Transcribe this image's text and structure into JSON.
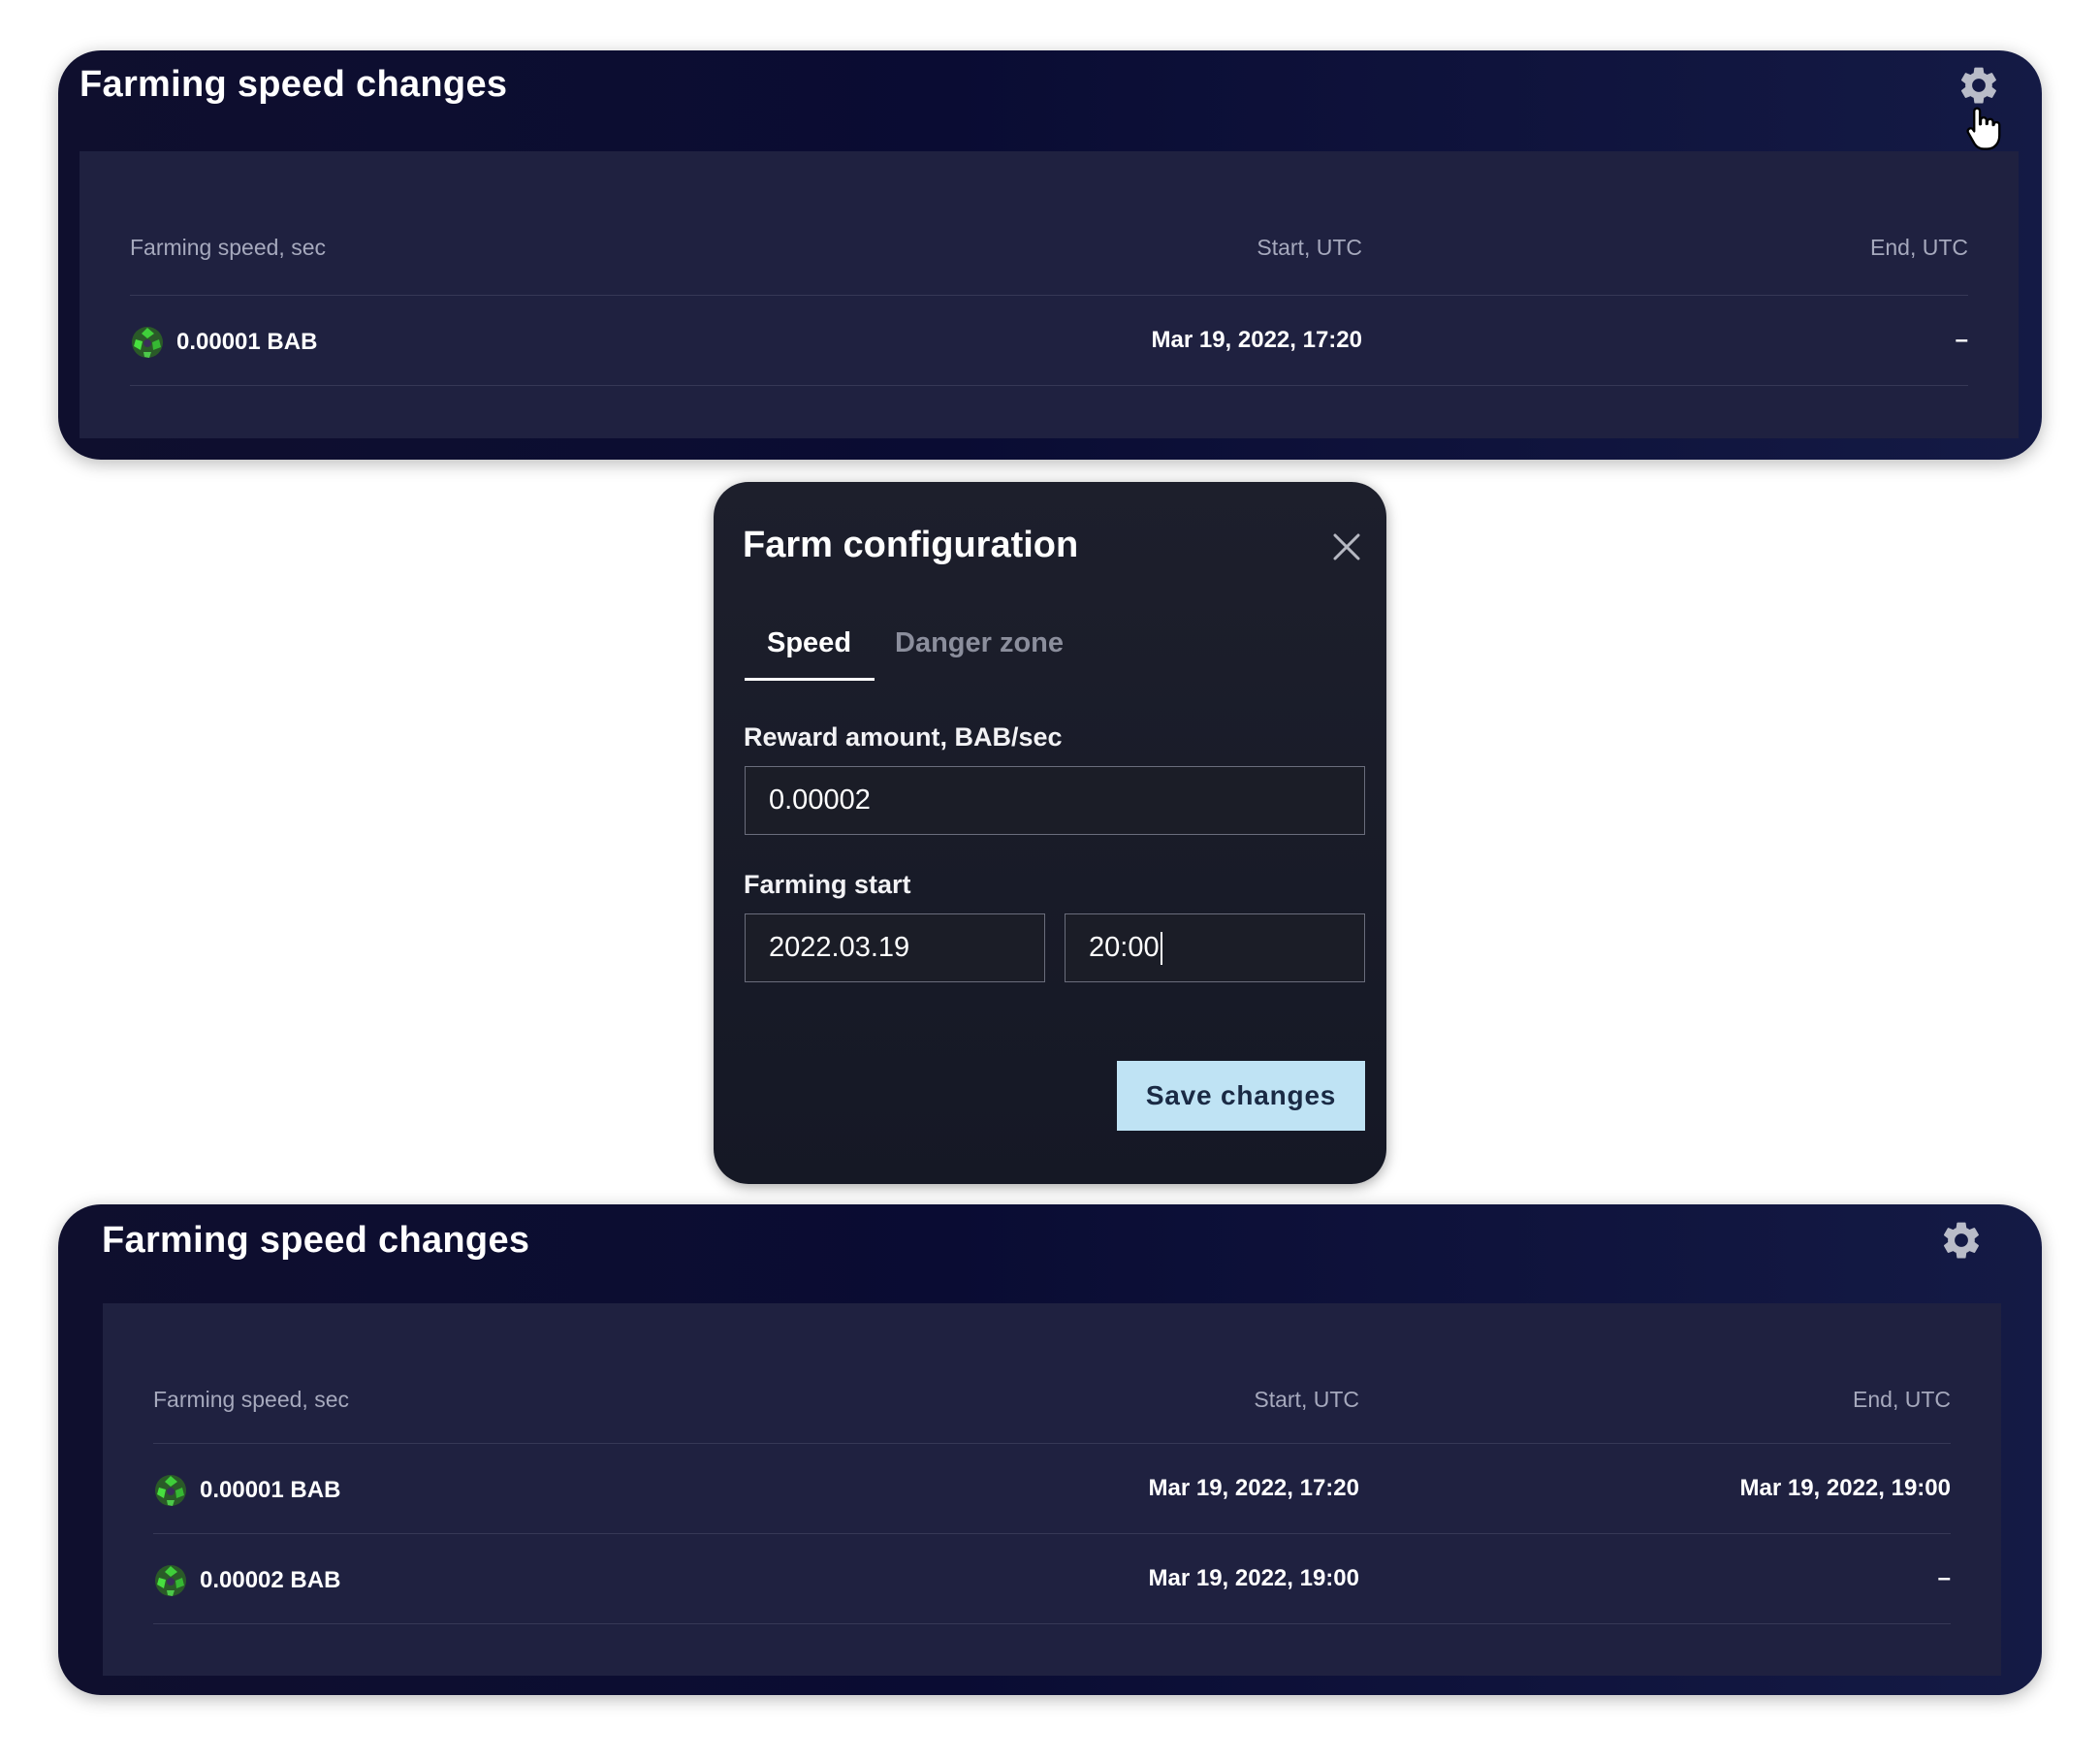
{
  "panel_top": {
    "title": "Farming speed changes",
    "columns": [
      "Farming speed, sec",
      "Start, UTC",
      "End, UTC"
    ],
    "rows": [
      {
        "speed": "0.00001 BAB",
        "start": "Mar 19, 2022, 17:20",
        "end": "–"
      }
    ]
  },
  "modal": {
    "title": "Farm configuration",
    "tabs": [
      {
        "label": "Speed",
        "active": true
      },
      {
        "label": "Danger zone",
        "active": false
      }
    ],
    "reward_label": "Reward amount, BAB/sec",
    "reward_value": "0.00002",
    "start_label": "Farming start",
    "date_value": "2022.03.19",
    "time_value": "20:00",
    "save_label": "Save changes"
  },
  "panel_bottom": {
    "title": "Farming speed changes",
    "columns": [
      "Farming speed, sec",
      "Start, UTC",
      "End, UTC"
    ],
    "rows": [
      {
        "speed": "0.00001 BAB",
        "start": "Mar 19, 2022, 17:20",
        "end": "Mar 19, 2022, 19:00"
      },
      {
        "speed": "0.00002 BAB",
        "start": "Mar 19, 2022, 19:00",
        "end": "–"
      }
    ]
  },
  "colors": {
    "panel_bg": "#0a0c33",
    "table_bg": "#1f2140",
    "modal_bg": "#1a1c28",
    "accent_button": "#bfe3f4",
    "token_green": "#3fcf3a"
  },
  "icons": {
    "settings": "gear-icon",
    "close": "close-icon",
    "token": "bab-token-icon",
    "cursor": "hand-cursor-icon"
  }
}
